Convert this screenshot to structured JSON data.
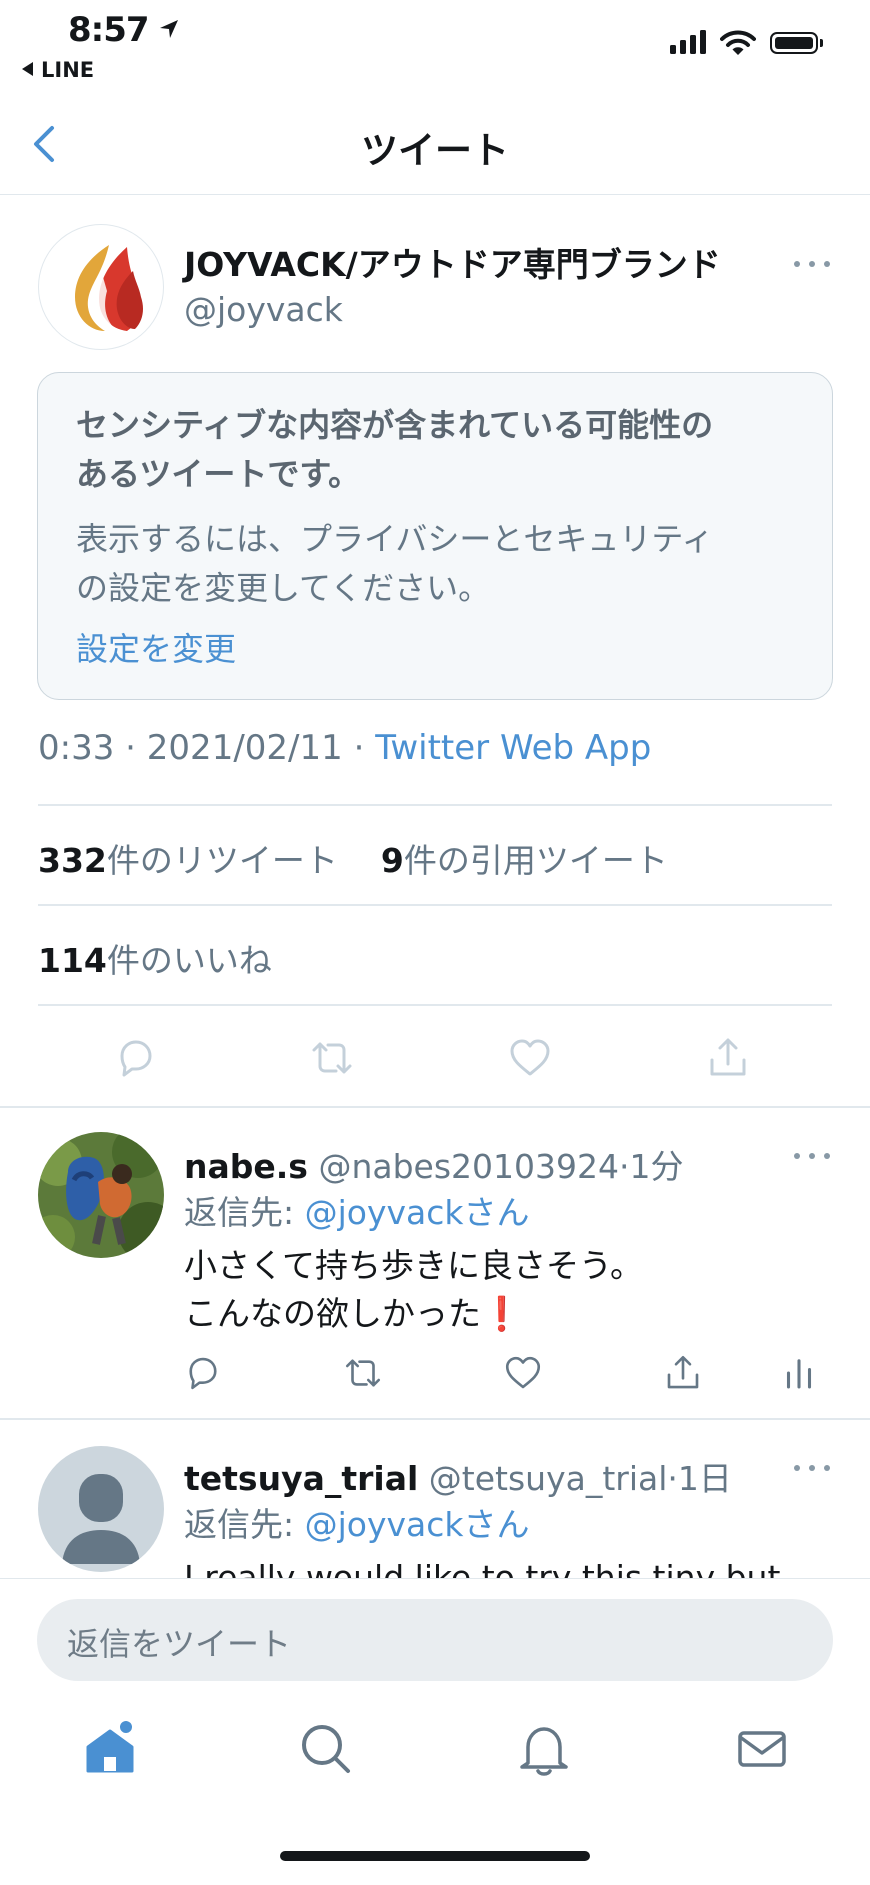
{
  "status_bar": {
    "time": "8:57",
    "back_app": "LINE"
  },
  "nav": {
    "title": "ツイート"
  },
  "tweet": {
    "author_name": "JOYVACK/アウトドア専門ブランド",
    "author_handle": "@joyvack",
    "sensitive": {
      "title_line1": "センシティブな内容が含まれている可能性の",
      "title_line2": "あるツイートです。",
      "body_line1": "表示するには、プライバシーとセキュリティ",
      "body_line2": "の設定を変更してください。",
      "link": "設定を変更"
    },
    "time": "0:33",
    "date": "2021/02/11",
    "separator": "·",
    "source": "Twitter Web App",
    "retweet_count": "332",
    "retweet_label": "件のリツイート",
    "quote_count": "9",
    "quote_label": "件の引用ツイート",
    "like_count": "114",
    "like_label": "件のいいね"
  },
  "replies": [
    {
      "name": "nabe.s",
      "handle": "@nabes20103924",
      "time": "·1分",
      "reply_to_label": "返信先:",
      "reply_to": "@joyvackさん",
      "text_line1": "小さくて持ち歩きに良さそう。",
      "text_line2": "こんなの欲しかった",
      "emoji": "❗"
    },
    {
      "name": "tetsuya_trial",
      "handle": "@tetsuya_trial",
      "time": "·1日",
      "reply_to_label": "返信先:",
      "reply_to": "@joyvackさん",
      "text_line1": "I really would like to try this tiny but"
    }
  ],
  "compose": {
    "placeholder": "返信をツイート"
  },
  "icons": {
    "accent": "#4a90d2",
    "secondary": "#8899a6",
    "tab_bar": [
      "home-icon",
      "search-icon",
      "bell-icon",
      "mail-icon"
    ],
    "actions": [
      "reply-icon",
      "retweet-icon",
      "like-icon",
      "share-icon",
      "analytics-icon"
    ]
  }
}
